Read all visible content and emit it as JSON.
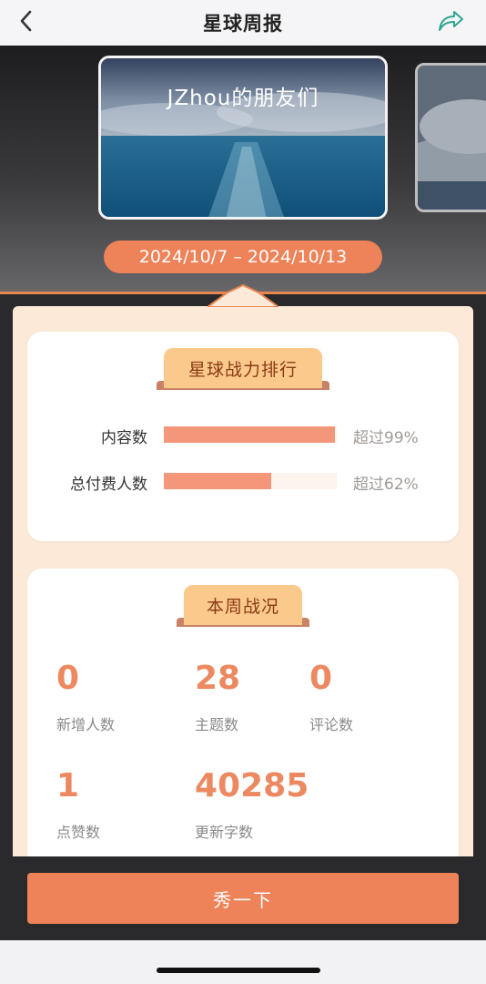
{
  "header": {
    "title": "星球周报",
    "back_icon": "chevron-left-icon",
    "share_icon": "share-arrow-icon"
  },
  "hero": {
    "card_title": "JZhou的朋友们",
    "date_range": "2024/10/7 – 2024/10/13"
  },
  "ranking": {
    "title": "星球战力排行",
    "items": [
      {
        "label": "内容数",
        "fill_percent": 99,
        "text": "超过99%"
      },
      {
        "label": "总付费人数",
        "fill_percent": 62,
        "text": "超过62%"
      }
    ]
  },
  "weekly": {
    "title": "本周战况",
    "stats": [
      {
        "value": "0",
        "label": "新增人数"
      },
      {
        "value": "28",
        "label": "主题数"
      },
      {
        "value": "0",
        "label": "评论数"
      },
      {
        "value": "1",
        "label": "点赞数"
      },
      {
        "value": "40285",
        "label": "更新字数"
      }
    ]
  },
  "cta": {
    "label": "秀一下"
  },
  "colors": {
    "accent": "#ee8259",
    "bar_fill": "#f4967a",
    "ribbon": "#fcc98c",
    "panel": "#fde9d7",
    "share_icon": "#2fa48e"
  }
}
